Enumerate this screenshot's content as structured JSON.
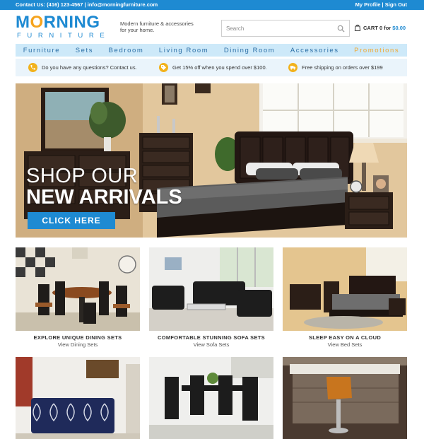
{
  "topbar": {
    "contact": "Contact Us: (416) 123-4567 | info@morningfurniture.com",
    "profile": "My Profile",
    "separator": "|",
    "signout": "Sign Out"
  },
  "header": {
    "logo_prefix": "M",
    "logo_sun_letter": "O",
    "logo_suffix": "RNING",
    "logo_subword": "FURNITURE",
    "tagline": "Modern furniture & accessories for your home.",
    "search_placeholder": "Search",
    "cart_label": "CART",
    "cart_count": "0",
    "cart_for": "for",
    "cart_total": "$0.00"
  },
  "nav": {
    "items": [
      "Furniture",
      "Sets",
      "Bedroom",
      "Living Room",
      "Dining Room",
      "Accessories",
      "Promotions"
    ]
  },
  "info": [
    {
      "icon": "phone-icon",
      "text": "Do you have any questions? Contact us."
    },
    {
      "icon": "discount-icon",
      "text": "Get 15% off when you spend over $100."
    },
    {
      "icon": "shipping-icon",
      "text": "Free shipping on orders over $199"
    }
  ],
  "hero": {
    "line1": "SHOP OUR",
    "line2": "NEW ARRIVALS",
    "cta": "CLICK HERE"
  },
  "categories": [
    {
      "title": "EXPLORE UNIQUE DINING SETS",
      "link": "View Dining Sets"
    },
    {
      "title": "COMFORTABLE STUNNING SOFA SETS",
      "link": "View Sofa Sets"
    },
    {
      "title": "SLEEP EASY ON A CLOUD",
      "link": "View Bed Sets"
    }
  ],
  "colors": {
    "brand_blue": "#1e8ad2",
    "sun_orange": "#f5a41f",
    "nav_bg": "#cde9f9",
    "promo": "#f0a833",
    "info_bg": "#eaf4fb",
    "info_icon": "#f2b21c"
  }
}
